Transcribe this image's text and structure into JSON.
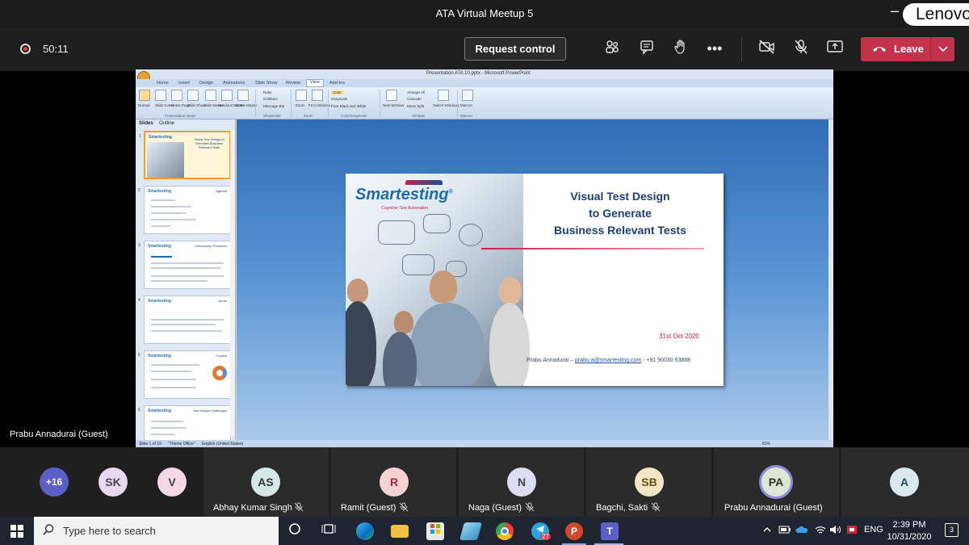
{
  "window": {
    "title": "ATA Virtual Meetup 5",
    "minimize_glyph": "–",
    "brand": "Lenovo"
  },
  "toolbar": {
    "timer": "50:11",
    "request_control": "Request control",
    "icons": [
      "people-icon",
      "chat-icon",
      "raise-hand-icon",
      "more-options-icon",
      "camera-off-icon",
      "mic-off-icon",
      "share-tray-icon"
    ],
    "more_glyph": "•••",
    "leave_label": "Leave",
    "leave_color": "#c4314b"
  },
  "presentation": {
    "window_title": "Presentation ATA 10.pptx - Microsoft PowerPoint",
    "ribbon_tabs": [
      "Home",
      "Insert",
      "Design",
      "Animations",
      "Slide Show",
      "Review",
      "View",
      "Add-Ins"
    ],
    "active_tab": "View",
    "ribbon_groups": [
      "Presentation Views",
      "Show/Hide",
      "Zoom",
      "Color/Grayscale",
      "Window",
      "Macros"
    ],
    "ribbon_items": [
      "Normal",
      "Slide Sorter",
      "Notes Page",
      "Slide Show",
      "Slide Master",
      "Handout Master",
      "Notes Master",
      "Ruler",
      "Gridlines",
      "Message Bar",
      "Zoom",
      "Fit to Window",
      "Color",
      "Grayscale",
      "Pure Black and White",
      "New Window",
      "Arrange All",
      "Cascade",
      "Move Split",
      "Switch Windows",
      "Macros"
    ],
    "pane_tabs": [
      "Slides",
      "Outline"
    ],
    "thumb_titles": [
      "Visual Test Design to Generate Business Relevant Tests",
      "Agenda",
      "Introductory Presenter",
      "Quote",
      "Context",
      "Test Design Challenges"
    ],
    "status": {
      "slide": "Slide 1 of 19",
      "theme": "\"Theme Office\"",
      "language": "English (United States)",
      "zoom": "81%"
    }
  },
  "slide": {
    "brand": "Smartesting",
    "brand_mark": "®",
    "tagline": "Cognitive Test Automation",
    "title_lines": [
      "Visual Test Design",
      "to Generate",
      "Business Relevant Tests"
    ],
    "date": "31st Oct 2020",
    "author": "Prabu Annadurai –",
    "email": "prabu.a@smartesting.com",
    "phone": "- +91 90030 63888",
    "accent": "#c6204a",
    "title_color": "#1b3f78"
  },
  "presenter_label": "Prabu Annadurai (Guest)",
  "participants": {
    "overflow": "+16",
    "small": [
      {
        "initials": "SK",
        "color": "#e8d9f2"
      },
      {
        "initials": "V",
        "color": "#f6d7e6"
      }
    ],
    "tiles": [
      {
        "initials": "AS",
        "name": "Abhay Kumar Singh",
        "color": "#d5e8e8"
      },
      {
        "initials": "R",
        "name": "Ramit (Guest)",
        "color": "#f6d2d2"
      },
      {
        "initials": "N",
        "name": "Naga (Guest)",
        "color": "#dcdcf2"
      },
      {
        "initials": "SB",
        "name": "Bagchi, Sakti",
        "color": "#f3e6c4"
      },
      {
        "initials": "PA",
        "name": "Prabu Annadurai (Guest)",
        "color": "#dde6d2"
      },
      {
        "initials": "A",
        "name": "",
        "color": "#dbe8ee"
      }
    ]
  },
  "taskbar": {
    "search_placeholder": "Type here to search",
    "badge": "27",
    "apps": [
      "task-view-icon",
      "edge-icon",
      "file-explorer-icon",
      "store-icon",
      "snip-icon",
      "chrome-icon",
      "telegram-icon",
      "powerpoint-icon",
      "teams-icon"
    ],
    "language": "ENG",
    "time": "2:39 PM",
    "date": "10/31/2020",
    "notifications": "3"
  }
}
